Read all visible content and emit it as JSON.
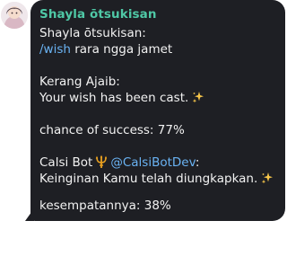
{
  "avatar": {
    "icon": "user-avatar-icon"
  },
  "message": {
    "sender": "Shayla ōtsukisan",
    "quote_author": "Shayla ōtsukisan:",
    "command": "/wish",
    "command_args": " rara ngga jamet",
    "bot1_name": "Kerang Ajaib:",
    "bot1_reply": "Your wish has been cast.",
    "bot1_chance": "chance of success: 77%",
    "bot2_name": "Calsi Bot",
    "bot2_handle": "@CalsiBotDev",
    "bot2_handle_suffix": ":",
    "bot2_reply": "Keinginan Kamu telah diungkapkan.",
    "bot2_chance": "kesempatannya: 38%",
    "icons": {
      "sparkle": "sparkles-icon",
      "trident": "trident-icon"
    }
  },
  "colors": {
    "bubble": "#1e1f24",
    "sender": "#4fc8a6",
    "link": "#6ab3f3",
    "text": "#f2f2f2"
  }
}
